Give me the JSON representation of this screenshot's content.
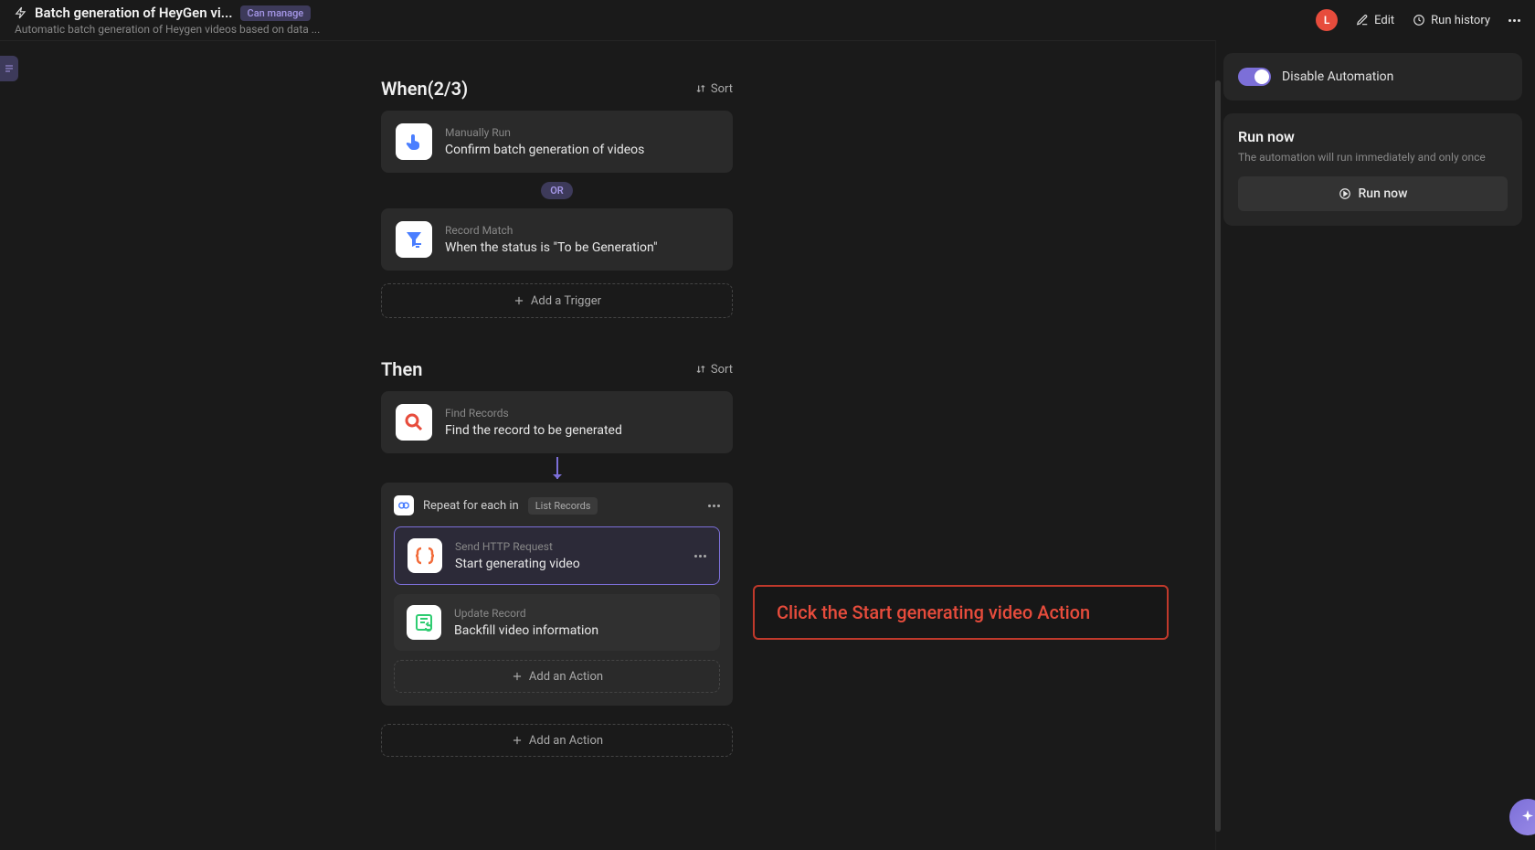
{
  "header": {
    "title": "Batch generation of HeyGen vi...",
    "badge": "Can manage",
    "subtitle": "Automatic batch generation of Heygen videos based on data ...",
    "avatar_letter": "L",
    "edit": "Edit",
    "run_history": "Run history"
  },
  "when": {
    "title": "When(2/3)",
    "sort": "Sort",
    "or": "OR",
    "add_trigger": "Add a Trigger",
    "triggers": [
      {
        "type": "Manually Run",
        "title": "Confirm batch generation of videos",
        "icon": "hand-tap"
      },
      {
        "type": "Record Match",
        "title": "When the status is \"To be Generation\"",
        "icon": "filter"
      }
    ]
  },
  "then": {
    "title": "Then",
    "sort": "Sort",
    "find": {
      "type": "Find Records",
      "title": "Find the record to be generated"
    },
    "loop": {
      "label": "Repeat for each in",
      "pill": "List Records",
      "actions": [
        {
          "type": "Send HTTP Request",
          "title": "Start generating video",
          "icon": "http",
          "selected": true
        },
        {
          "type": "Update Record",
          "title": "Backfill video information",
          "icon": "update",
          "selected": false
        }
      ],
      "add_action": "Add an Action"
    },
    "add_action": "Add an Action"
  },
  "callout": "Click the Start generating video Action",
  "right": {
    "disable": "Disable Automation",
    "run_title": "Run now",
    "run_desc": "The automation will run immediately and only once",
    "run_btn": "Run now"
  },
  "colors": {
    "accent": "#7c6fd8",
    "danger": "#e74c3c"
  }
}
